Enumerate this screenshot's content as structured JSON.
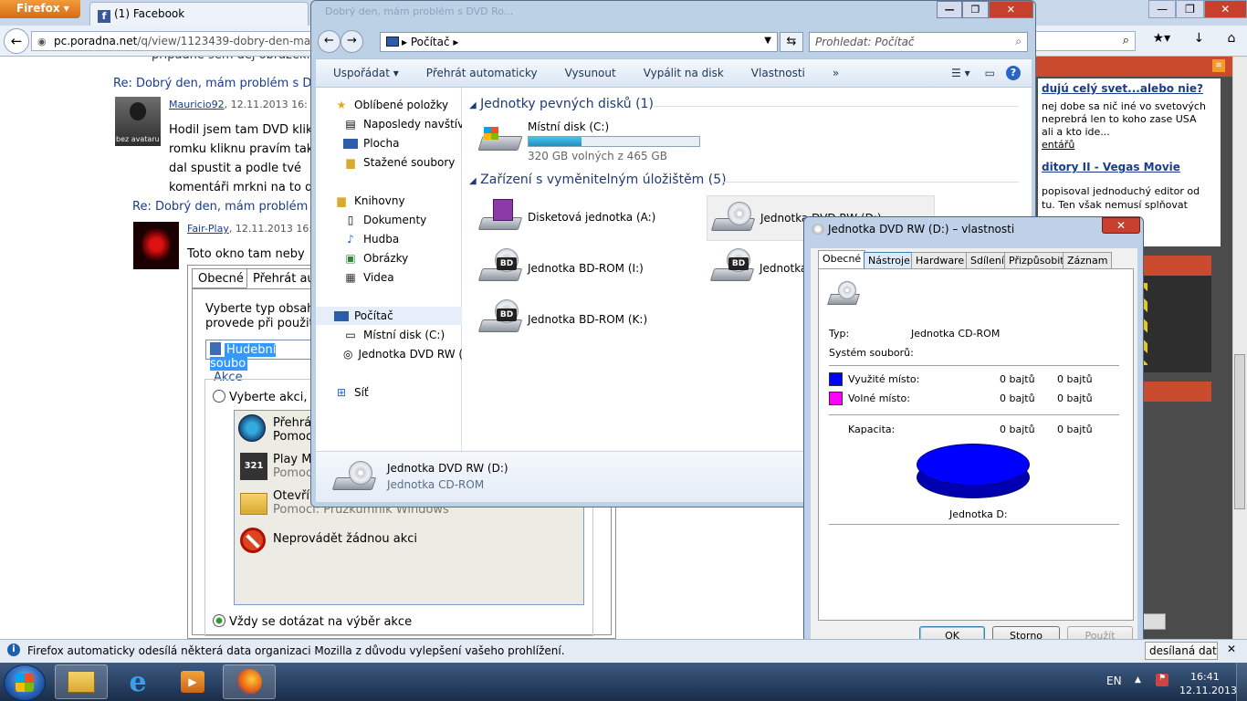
{
  "firefox": {
    "menu_label": "Firefox",
    "tab_title": "(1) Facebook",
    "url_domain": "pc.poradna.net",
    "url_path": "/q/view/1123439-dobry-den-mam-pro",
    "win_min": "—",
    "win_max": "❐",
    "win_close": "✕",
    "notification": "Firefox automaticky odesílá některá data organizaci Mozilla z důvodu vylepšení vašeho prohlížení.",
    "notification_button": "desílaná data"
  },
  "webpage": {
    "top_fragment": "případně sem dej obrázek.",
    "post1": {
      "title": "Re: Dobrý den, mám problém s DVD",
      "author": "Mauricio92",
      "date": "12.11.2013 16:",
      "avatar_label": "bez avataru",
      "lines": [
        "Hodil jsem tam DVD klik",
        "romku kliknu pravím tak",
        "dal spustit a podle tvé",
        "komentáři mrkni na to d"
      ]
    },
    "post2": {
      "title": "Re: Dobrý den, mám problém s",
      "author": "Fair-Play",
      "date": "12.11.2013 16:",
      "text": "Toto okno tam neby"
    },
    "right": {
      "title1": "dujú celý svet...alebo nie?",
      "text1": [
        "nej dobe sa nič iné vo svetových",
        "neprebrá len to koho zase USA",
        "ali a kto ide..."
      ],
      "link1": "entářů",
      "title2": "ditory II - Vegas Movie",
      "text2": [
        "popisoval jednoduchý editor od",
        "tu. Ten však nemusí splňovat"
      ]
    }
  },
  "autoplay": {
    "tab_general": "Obecné",
    "tab_autoplay": "Přehrát aut",
    "instruction": [
      "Vyberte typ obsahu",
      "provede při použití"
    ],
    "select_value": "Hudební soubo",
    "actions_label": "Akce",
    "radio_choose": "Vyberte akci, k",
    "items": [
      {
        "title": "Přehrát",
        "sub": "Pomoc"
      },
      {
        "title": "Play M",
        "sub": "Pomoc"
      },
      {
        "title": "Otevřít",
        "sub": "Pomocí: Průzkumník Windows"
      },
      {
        "title": "Neprovádět žádnou akci",
        "sub": ""
      }
    ],
    "radio_ask": "Vždy se dotázat na výběr akce"
  },
  "explorer": {
    "tab_hint": "Dobrý den, mám problém s DVD Ro...",
    "address": "Počítač",
    "search_placeholder": "Prohledat: Počítač",
    "commands": [
      "Uspořádat ▾",
      "Přehrát automaticky",
      "Vysunout",
      "Vypálit na disk",
      "Vlastnosti",
      "»"
    ],
    "nav": {
      "favorites": "Oblíbené položky",
      "recent": "Naposledy navštíven",
      "desktop": "Plocha",
      "downloads": "Stažené soubory",
      "libraries": "Knihovny",
      "documents": "Dokumenty",
      "music": "Hudba",
      "pictures": "Obrázky",
      "videos": "Videa",
      "computer": "Počítač",
      "local_disk": "Místní disk (C:)",
      "dvd_drive": "Jednotka DVD RW (D",
      "network": "Síť"
    },
    "group_hdd": "Jednotky pevných disků (1)",
    "group_removable": "Zařízení s vyměnitelným úložištěm (5)",
    "local_disk": {
      "name": "Místní disk (C:)",
      "free": "320 GB volných z 465 GB",
      "used_fraction": 0.31
    },
    "drives": [
      {
        "name": "Disketová jednotka (A:)"
      },
      {
        "name": "Jednotka DVD RW (D:)"
      },
      {
        "name": "Jednotka BD-ROM (I:)"
      },
      {
        "name": "Jednotka"
      },
      {
        "name": "Jednotka BD-ROM (K:)"
      }
    ],
    "bd_tag": "BD",
    "details_name": "Jednotka DVD RW (D:)",
    "details_type": "Jednotka CD-ROM"
  },
  "properties": {
    "title": "Jednotka DVD RW (D:) – vlastnosti",
    "close": "✕",
    "tabs": [
      "Obecné",
      "Nástroje",
      "Hardware",
      "Sdílení",
      "Přizpůsobit",
      "Záznam"
    ],
    "type_label": "Typ:",
    "type_value": "Jednotka CD-ROM",
    "fs_label": "Systém souborů:",
    "used_label": "Využité místo:",
    "used_bytes": "0 bajtů",
    "used_bytes2": "0 bajtů",
    "free_label": "Volné místo:",
    "free_bytes": "0 bajtů",
    "free_bytes2": "0 bajtů",
    "capacity_label": "Kapacita:",
    "capacity_bytes": "0 bajtů",
    "capacity_bytes2": "0 bajtů",
    "drive_caption": "Jednotka D:",
    "btn_ok": "OK",
    "btn_cancel": "Storno",
    "btn_apply": "Použít",
    "colors": {
      "used": "#0000ff",
      "free": "#ff00ff"
    }
  },
  "tray": {
    "lang": "EN",
    "time": "16:41",
    "date": "12.11.2013"
  }
}
